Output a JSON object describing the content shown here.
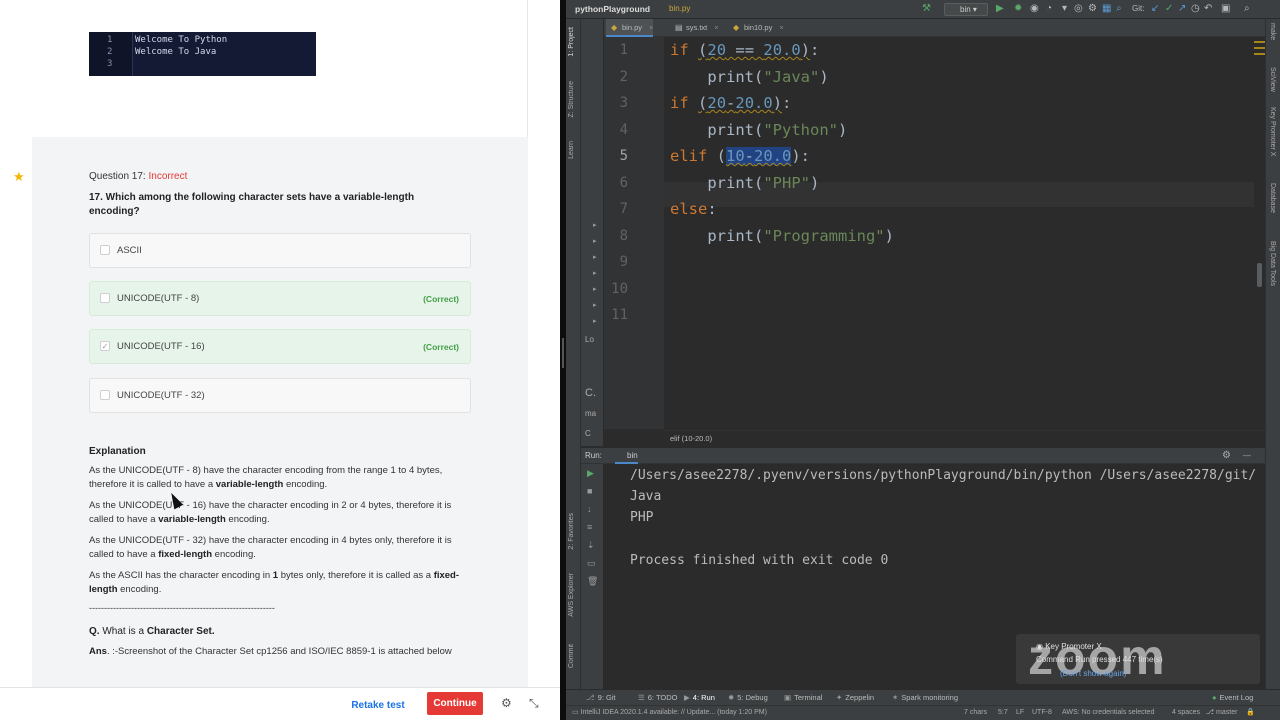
{
  "quiz": {
    "code_lines": [
      {
        "n": "1",
        "t": "Welcome To Python"
      },
      {
        "n": "2",
        "t": "Welcome To Java"
      },
      {
        "n": "3",
        "t": ""
      }
    ],
    "question_label": "Question 17:",
    "question_status": "Incorrect",
    "question_text": "17. Which among the following character sets have a variable-length encoding?",
    "options": [
      {
        "label": "ASCII",
        "tag": "",
        "checked": false,
        "correct": false
      },
      {
        "label": "UNICODE(UTF - 8)",
        "tag": "(Correct)",
        "checked": false,
        "correct": true
      },
      {
        "label": "UNICODE(UTF - 16)",
        "tag": "(Correct)",
        "checked": true,
        "correct": true
      },
      {
        "label": "UNICODE(UTF - 32)",
        "tag": "",
        "checked": false,
        "correct": false
      }
    ],
    "explanation_title": "Explanation",
    "para1": {
      "a": "As the UNICODE(UTF - 8)  have the character encoding from the range 1 to 4 bytes, therefore it is called to have a ",
      "b": "variable-length",
      "c": " encoding."
    },
    "para2": {
      "a": "As the UNICODE(UTF - 16) have the character encoding in 2 or 4 bytes, therefore it is called to have a ",
      "b": "variable-length",
      "c": " encoding."
    },
    "para3": {
      "a": "As the UNICODE(UTF - 32) have the character encoding in 4 bytes only, therefore it is called to have a ",
      "b": "fixed-length",
      "c": " encoding."
    },
    "para4": {
      "a": "As the ASCII has the character encoding in ",
      "b1": "1",
      "m": " bytes only, therefore it is called as a ",
      "b": "fixed-length",
      "c": " encoding."
    },
    "rule": "--------------------------------------------------------------",
    "q2": {
      "a": "Q.",
      "m": " What is a ",
      "b": "Character Set."
    },
    "ans": {
      "a": "Ans",
      "m": ". :-Screenshot of the Character Set cp1256 and ISO/IEC 8859-1  is attached below"
    },
    "footer": {
      "retake": "Retake test",
      "continue": "Continue"
    }
  },
  "ide": {
    "project": "pythonPlayground",
    "crumb": "bin.py",
    "run_config": "bin",
    "git_label": "Git:",
    "tabs": [
      "bin.py",
      "sys.txt",
      "bin10.py"
    ],
    "left_tabs": [
      "1: Project",
      "Z: Structure",
      "Learn",
      "2: Favorites",
      "AWS Explorer",
      "Commit"
    ],
    "right_tabs": [
      "make",
      "SciView",
      "Key Promoter X",
      "Database",
      "Big Data Tools"
    ],
    "line_numbers": [
      "1",
      "2",
      "3",
      "4",
      "5",
      "6",
      "7",
      "8",
      "9",
      "10",
      "11"
    ],
    "breadcrumb_status": "elif (10-20.0)",
    "run_label": "Run:",
    "run_tab": "bin",
    "console": [
      "/Users/asee2278/.pyenv/versions/pythonPlayground/bin/python /Users/asee2278/git/",
      "Java",
      "PHP",
      "",
      "Process finished with exit code 0"
    ],
    "bottom_tabs": [
      "9: Git",
      "6: TODO",
      "4: Run",
      "5: Debug",
      "Terminal",
      "Zeppelin",
      "Spark monitoring",
      "Event Log"
    ],
    "status": {
      "left": "IntelliJ IDEA 2020.1.4 available: // Update... (today 1:20 PM)",
      "chars": "7 chars",
      "pos": "5:7",
      "lf": "LF",
      "enc": "UTF-8",
      "aws": "AWS: No credentials selected",
      "indent": "4 spaces",
      "branch": "master"
    },
    "panel_mini": [
      "Lo",
      "C.",
      "ma",
      "C"
    ]
  },
  "zoom": {
    "word": "zoom",
    "title": "Key Promoter X",
    "sub": "Command Run pressed 447 time(s)",
    "link": "(Don't show again)"
  }
}
